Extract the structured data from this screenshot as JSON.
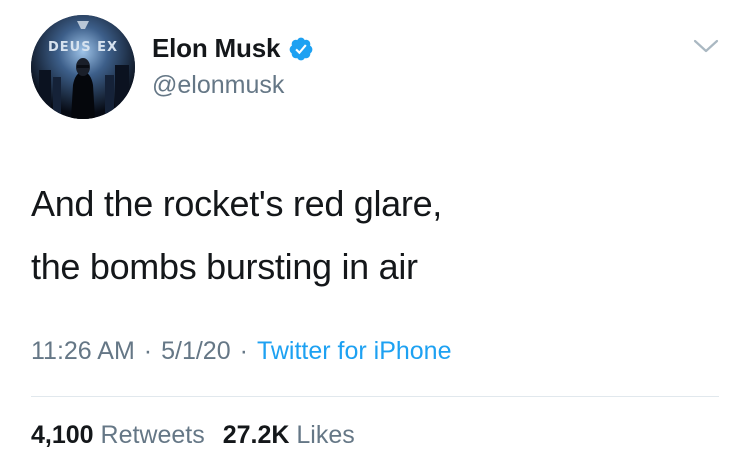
{
  "tweet": {
    "avatar": {
      "alt_logo_text": "DEUS EX",
      "icon": "avatar-image"
    },
    "author": {
      "display_name": "Elon Musk",
      "handle": "@elonmusk",
      "verified": true,
      "verified_icon": "verified-badge-icon"
    },
    "menu_icon": "chevron-down-icon",
    "text_lines": [
      "And the rocket's red glare,",
      "the bombs bursting in air"
    ],
    "time": "11:26 AM",
    "date": "5/1/20",
    "separator": "·",
    "source": "Twitter for iPhone",
    "stats": {
      "retweets_count": "4,100",
      "retweets_label": "Retweets",
      "likes_count": "27.2K",
      "likes_label": "Likes"
    }
  },
  "colors": {
    "text_primary": "#14171a",
    "text_secondary": "#657786",
    "link": "#1da1f2",
    "verified": "#1da1f2",
    "divider": "#e1e8ed"
  }
}
